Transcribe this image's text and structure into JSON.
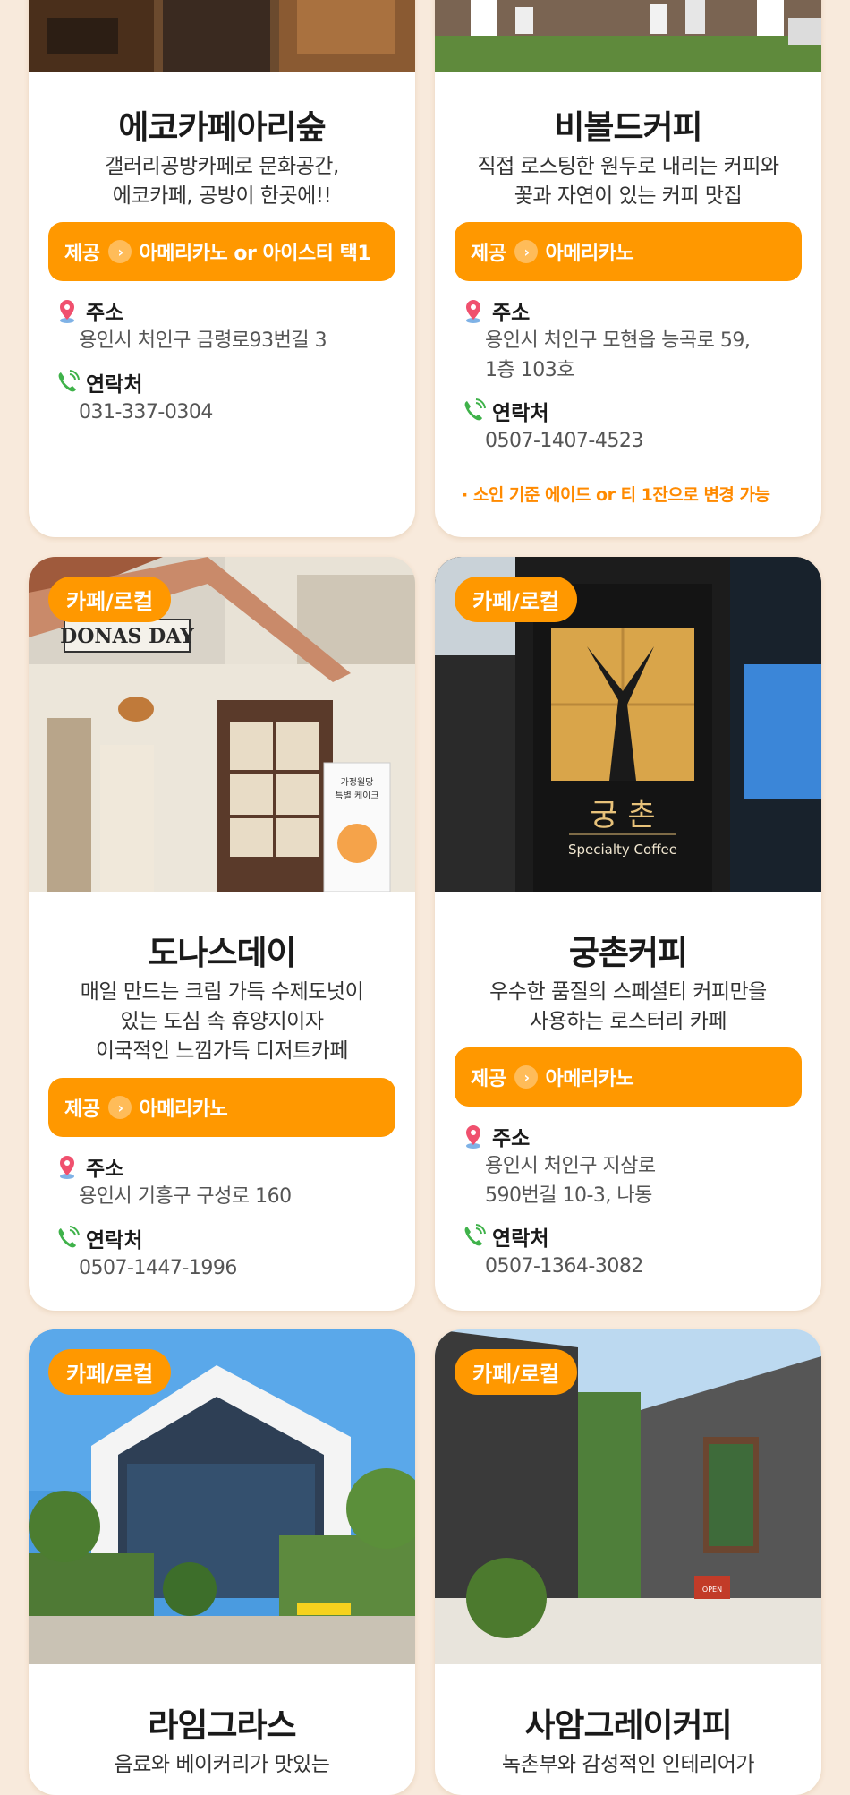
{
  "cards": [
    {
      "name": "에코카페아리숲",
      "desc": [
        "갤러리공방카페로 문화공간,",
        "에코카페, 공방이 한곳에!!"
      ],
      "provide_label": "제공",
      "provide_value": "아메리카노 or 아이스티 택1",
      "address_label": "주소",
      "address": [
        "용인시 처인구 금령로93번길 3"
      ],
      "contact_label": "연락처",
      "phone": "031-337-0304"
    },
    {
      "name": "비볼드커피",
      "desc": [
        "직접 로스팅한 원두로 내리는 커피와",
        "꽃과 자연이 있는 커피 맛집"
      ],
      "provide_label": "제공",
      "provide_value": "아메리카노",
      "address_label": "주소",
      "address": [
        "용인시 처인구 모현읍 능곡로 59,",
        "1층 103호"
      ],
      "contact_label": "연락처",
      "phone": "0507-1407-4523",
      "note": "· 소인 기준 에이드 or 티 1잔으로 변경 가능"
    },
    {
      "badge": "카페/로컬",
      "sign_text": "DONAS DAY",
      "banner_text": [
        "가정월당",
        "특별 케이크"
      ],
      "name": "도나스데이",
      "desc": [
        "매일 만드는 크림 가득 수제도넛이",
        "있는 도심 속 휴양지이자",
        "이국적인 느낌가득 디저트카페"
      ],
      "provide_label": "제공",
      "provide_value": "아메리카노",
      "address_label": "주소",
      "address": [
        "용인시 기흥구 구성로 160"
      ],
      "contact_label": "연락처",
      "phone": "0507-1447-1996"
    },
    {
      "badge": "카페/로컬",
      "sign_korean": "궁 촌",
      "sign_english": "Specialty Coffee",
      "name": "궁촌커피",
      "desc": [
        "우수한 품질의 스페셜티 커피만을",
        "사용하는 로스터리 카페"
      ],
      "provide_label": "제공",
      "provide_value": "아메리카노",
      "address_label": "주소",
      "address": [
        "용인시 처인구 지삼로",
        "590번길 10-3, 나동"
      ],
      "contact_label": "연락처",
      "phone": "0507-1364-3082"
    },
    {
      "badge": "카페/로컬",
      "name": "라임그라스",
      "desc": [
        "음료와 베이커리가 맛있는"
      ]
    },
    {
      "badge": "카페/로컬",
      "sign_text": "OPEN",
      "name": "사암그레이커피",
      "desc": [
        "녹촌부와 감성적인 인테리어가"
      ]
    }
  ],
  "colors": {
    "accent": "#ff9800",
    "background": "#f8eadc",
    "note": "#ff8a00"
  },
  "icons": {
    "address": "map-pin-icon",
    "contact": "phone-icon",
    "provide": "chevron-right-icon"
  }
}
